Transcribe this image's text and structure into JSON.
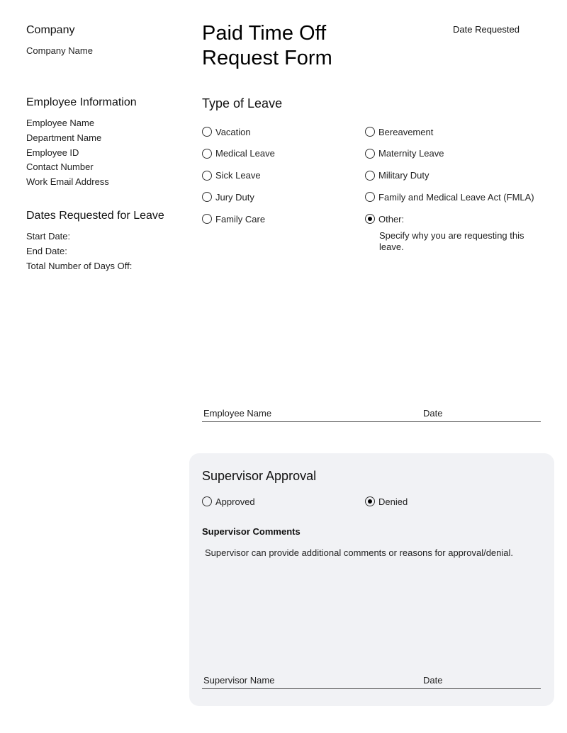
{
  "header": {
    "company_heading": "Company",
    "company_name": "Company Name",
    "title_line1": "Paid Time Off",
    "title_line2": "Request Form",
    "date_requested_label": "Date Requested"
  },
  "employee_info": {
    "heading": "Employee Information",
    "fields": [
      "Employee Name",
      "Department Name",
      "Employee ID",
      "Contact Number",
      "Work Email Address"
    ]
  },
  "dates_requested": {
    "heading": "Dates Requested for Leave",
    "fields": [
      "Start Date:",
      "End Date:",
      "Total Number of  Days Off:"
    ]
  },
  "type_of_leave": {
    "heading": "Type of Leave",
    "left_options": [
      {
        "label": "Vacation",
        "checked": false
      },
      {
        "label": "Medical Leave",
        "checked": false
      },
      {
        "label": "Sick Leave",
        "checked": false
      },
      {
        "label": "Jury Duty",
        "checked": false
      },
      {
        "label": "Family Care",
        "checked": false
      }
    ],
    "right_options": [
      {
        "label": "Bereavement",
        "checked": false
      },
      {
        "label": "Maternity Leave",
        "checked": false
      },
      {
        "label": "Military Duty",
        "checked": false
      },
      {
        "label": "Family and Medical Leave Act (FMLA)",
        "checked": false
      },
      {
        "label": "Other:",
        "checked": true
      }
    ],
    "other_note": "Specify why you are requesting this leave."
  },
  "employee_signature": {
    "name_label": "Employee Name",
    "date_label": "Date"
  },
  "supervisor": {
    "heading": "Supervisor Approval",
    "approved_label": "Approved",
    "approved_checked": false,
    "denied_label": "Denied",
    "denied_checked": true,
    "comments_heading": "Supervisor Comments",
    "comments_text": "Supervisor can provide additional comments or reasons for approval/denial.",
    "name_label": "Supervisor Name",
    "date_label": "Date"
  },
  "colors": {
    "panel_background": "#f1f2f5",
    "text": "#111111"
  }
}
